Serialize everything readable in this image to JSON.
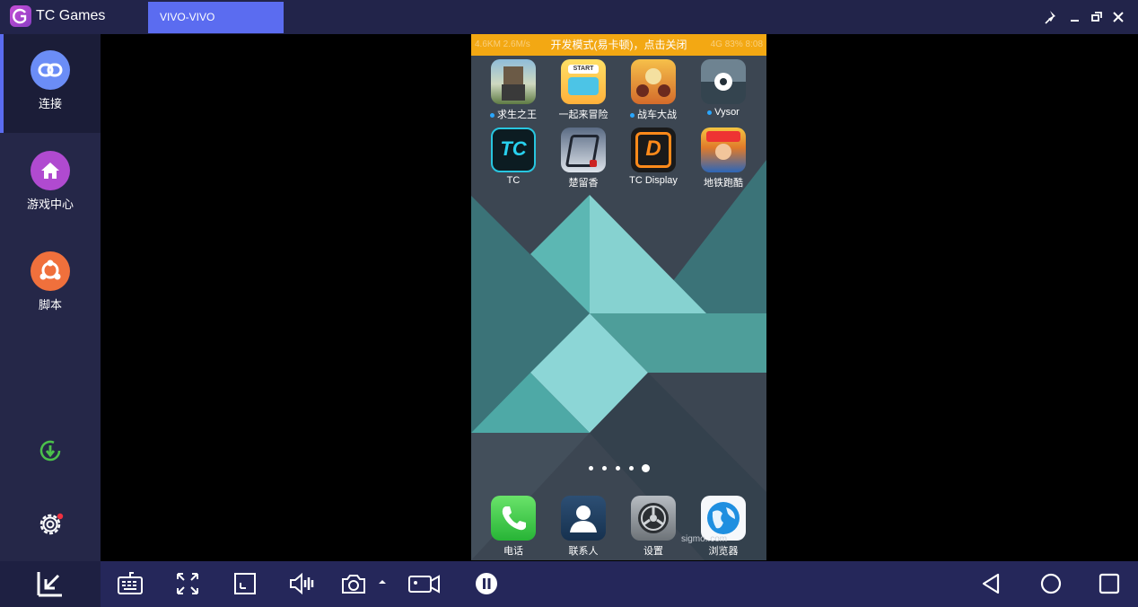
{
  "app": {
    "title": "TC Games",
    "device_tab": "VIVO-VIVO"
  },
  "sidebar": {
    "items": [
      {
        "label": "连接",
        "icon": "link-icon"
      },
      {
        "label": "游戏中心",
        "icon": "home-icon"
      },
      {
        "label": "脚本",
        "icon": "script-icon"
      }
    ],
    "download_icon": "download-icon",
    "settings_icon": "gear-icon"
  },
  "phone": {
    "notice": "开发模式(易卡顿)，点击关闭",
    "notice_left_ghost": "4.6KM  2.6M/s",
    "notice_right_ghost": "4G  83%  8:08",
    "apps": [
      {
        "label": "求生之王",
        "dot": true
      },
      {
        "label": "一起来冒险",
        "dot": false
      },
      {
        "label": "战车大战",
        "dot": true
      },
      {
        "label": "Vysor",
        "dot": true
      },
      {
        "label": "TC",
        "dot": false
      },
      {
        "label": "楚留香",
        "dot": false
      },
      {
        "label": "TC Display",
        "dot": false
      },
      {
        "label": "地铁跑酷",
        "dot": false
      }
    ],
    "page_dots": 5,
    "active_page": 5,
    "dock": [
      {
        "label": "电话"
      },
      {
        "label": "联系人"
      },
      {
        "label": "设置"
      },
      {
        "label": "浏览器"
      }
    ],
    "watermark": "sigmo..com"
  },
  "toolbar": {
    "icons": [
      "collapse-icon",
      "keyboard-icon",
      "fullscreen-icon",
      "window-fit-icon",
      "volume-icon",
      "screenshot-icon",
      "dropdown-arrow-icon",
      "record-icon",
      "pause-icon",
      "back-icon",
      "home-circle-icon",
      "recent-apps-icon"
    ]
  },
  "colors": {
    "accent": "#5b6cf0",
    "titlebar": "#22244a",
    "sidebar": "#252748",
    "notice": "#f3a813"
  }
}
